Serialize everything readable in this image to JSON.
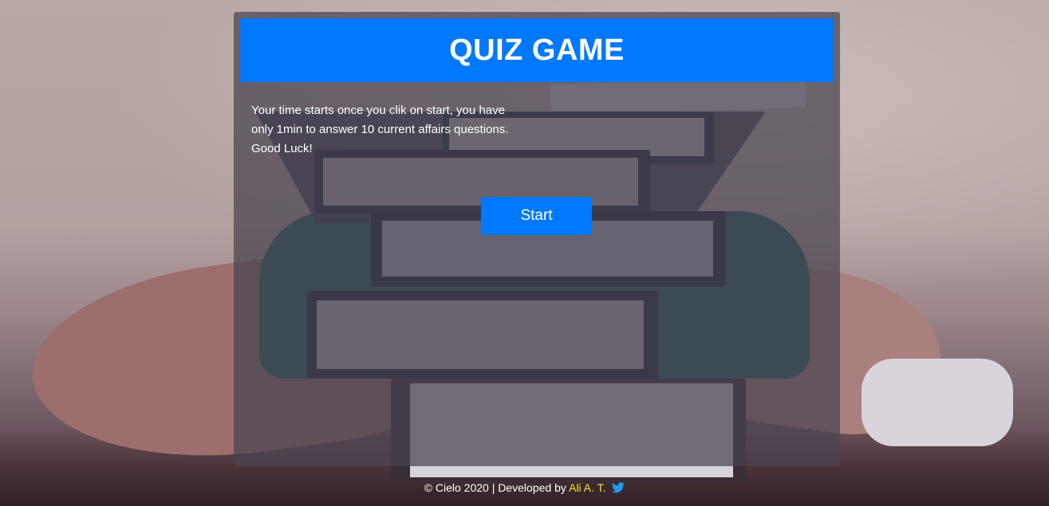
{
  "colors": {
    "accent": "#0078ff",
    "author_highlight": "#f2e12a",
    "twitter": "#1d9bf0"
  },
  "header": {
    "title": "QUIZ GAME"
  },
  "intro": {
    "text": "Your time starts once you clik on start, you have only 1min to answer 10 current affairs questions. Good Luck!"
  },
  "start_button": {
    "label": "Start"
  },
  "footer": {
    "copyright": "© Cielo 2020 | Developed by",
    "author": "Ali A. T.",
    "icon": "twitter-icon"
  }
}
